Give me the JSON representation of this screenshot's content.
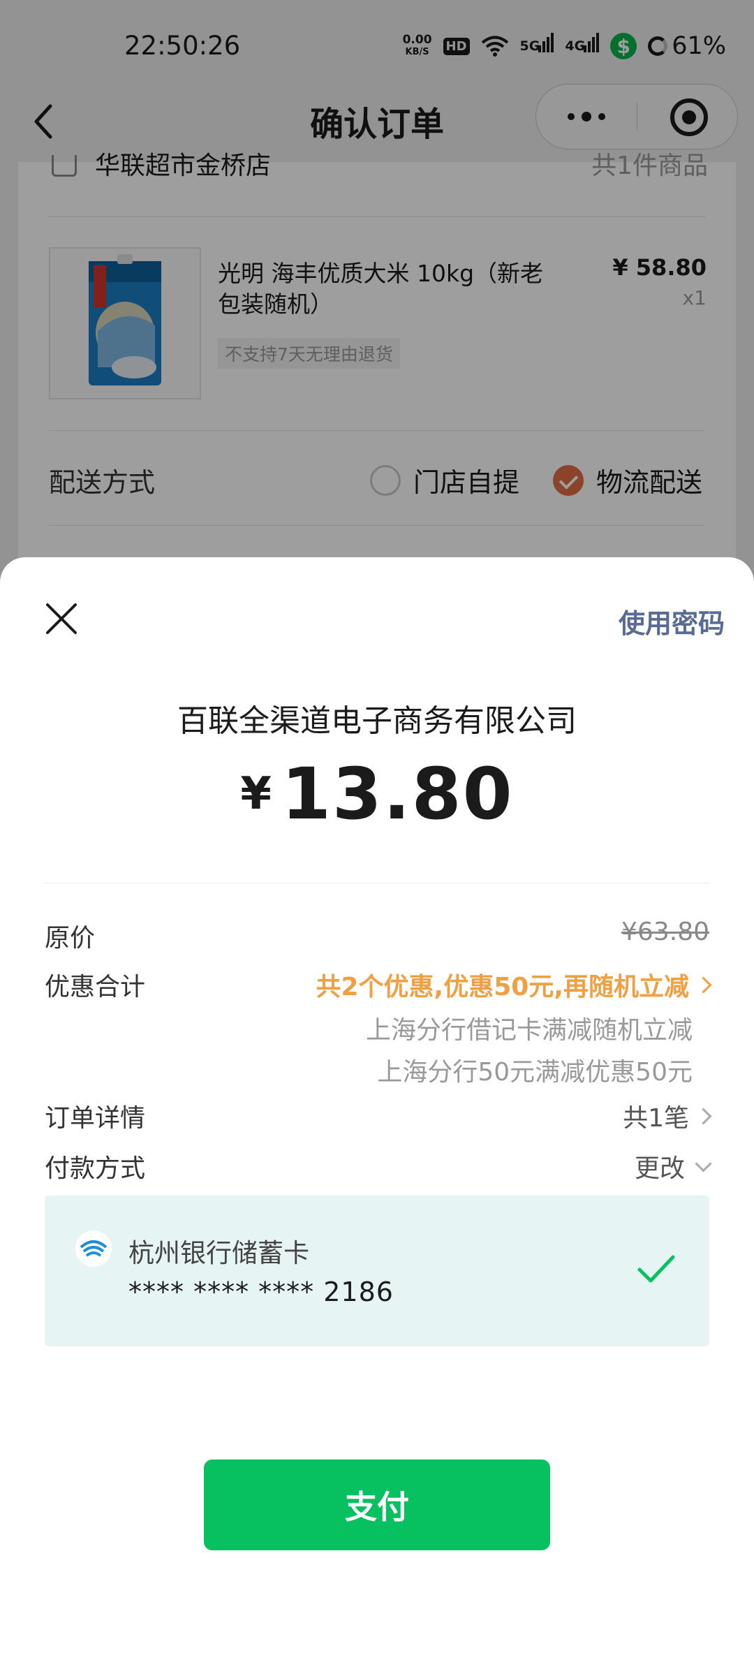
{
  "status_bar": {
    "time": "22:50:26",
    "net_speed_value": "0.00",
    "net_speed_unit": "KB/S",
    "hd_label": "HD",
    "net_5g": "5G",
    "net_4g": "4G",
    "battery": "61%"
  },
  "nav": {
    "title": "确认订单"
  },
  "order": {
    "partial_row_left": "华联超市金桥店",
    "partial_row_right": "共1件商品",
    "product": {
      "name": "光明 海丰优质大米 10kg（新老包装随机）",
      "tag": "不支持7天无理由退货",
      "price": "¥ 58.80",
      "qty": "x1"
    },
    "delivery": {
      "label": "配送方式",
      "option_pickup": "门店自提",
      "option_logistics": "物流配送",
      "selected": "物流配送"
    }
  },
  "payment_sheet": {
    "use_password": "使用密码",
    "merchant": "百联全渠道电子商务有限公司",
    "currency_symbol": "¥",
    "amount": "13.80",
    "original_price_label": "原价",
    "original_price": "¥63.80",
    "discount_label": "优惠合计",
    "discount_summary": "共2个优惠,优惠50元,再随机立减",
    "discount_items": [
      "上海分行借记卡满减随机立减",
      "上海分行50元满减优惠50元"
    ],
    "order_detail_label": "订单详情",
    "order_detail_value": "共1笔",
    "payment_method_label": "付款方式",
    "payment_method_change": "更改",
    "card": {
      "bank_name": "杭州银行储蓄卡",
      "card_number": "**** **** **** 2186"
    },
    "pay_button": "支付",
    "colors": {
      "accent_green": "#07c160",
      "discount_orange": "#f0a043",
      "link_blue": "#576b95"
    }
  }
}
